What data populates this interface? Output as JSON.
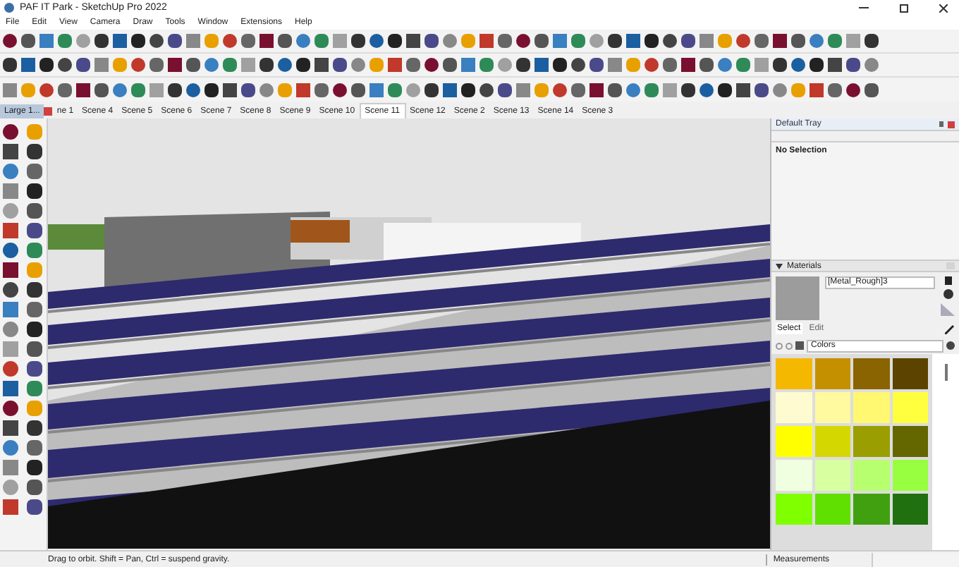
{
  "window": {
    "title": "PAF IT Park - SketchUp Pro 2022"
  },
  "menu": [
    "File",
    "Edit",
    "View",
    "Camera",
    "Draw",
    "Tools",
    "Window",
    "Extensions",
    "Help"
  ],
  "scene_tabs": [
    {
      "label": "Large 1...",
      "selected": true,
      "kind": "panel"
    },
    {
      "label": "ne 1",
      "selected": false,
      "kind": "scene"
    },
    {
      "label": "Scene 4",
      "selected": false,
      "kind": "scene"
    },
    {
      "label": "Scene 5",
      "selected": false,
      "kind": "scene"
    },
    {
      "label": "Scene 6",
      "selected": false,
      "kind": "scene"
    },
    {
      "label": "Scene 7",
      "selected": false,
      "kind": "scene"
    },
    {
      "label": "Scene 8",
      "selected": false,
      "kind": "scene"
    },
    {
      "label": "Scene 9",
      "selected": false,
      "kind": "scene"
    },
    {
      "label": "Scene 10",
      "selected": false,
      "kind": "scene"
    },
    {
      "label": "Scene 11",
      "selected": true,
      "kind": "scene"
    },
    {
      "label": "Scene 12",
      "selected": false,
      "kind": "scene"
    },
    {
      "label": "Scene 2",
      "selected": false,
      "kind": "scene"
    },
    {
      "label": "Scene 13",
      "selected": false,
      "kind": "scene"
    },
    {
      "label": "Scene 14",
      "selected": false,
      "kind": "scene"
    },
    {
      "label": "Scene 3",
      "selected": false,
      "kind": "scene"
    }
  ],
  "tray": {
    "title": "Default Tray",
    "entity_info": "No Selection",
    "materials": {
      "title": "Materials",
      "material_name": "[Metal_Rough]3",
      "tabs": [
        {
          "label": "Select",
          "selected": true
        },
        {
          "label": "Edit",
          "selected": false
        }
      ],
      "library": "Colors",
      "swatches": [
        {
          "color": "#f5b800"
        },
        {
          "color": "#c49000"
        },
        {
          "color": "#8a6400"
        },
        {
          "color": "#5c4400"
        },
        {
          "color": "#fffbd0"
        },
        {
          "color": "#fffaa0"
        },
        {
          "color": "#fff870"
        },
        {
          "color": "#ffff40"
        },
        {
          "color": "#ffff00"
        },
        {
          "color": "#d4d800"
        },
        {
          "color": "#9a9e00"
        },
        {
          "color": "#646600"
        },
        {
          "color": "#f0ffe0"
        },
        {
          "color": "#d8ffa0"
        },
        {
          "color": "#b8ff70"
        },
        {
          "color": "#98ff40"
        },
        {
          "color": "#80ff00"
        },
        {
          "color": "#60e000"
        },
        {
          "color": "#40a010"
        },
        {
          "color": "#207010"
        }
      ]
    }
  },
  "status_bar": {
    "hint": "Drag to orbit. Shift = Pan, Ctrl = suspend gravity.",
    "measurements_label": "Measurements"
  }
}
